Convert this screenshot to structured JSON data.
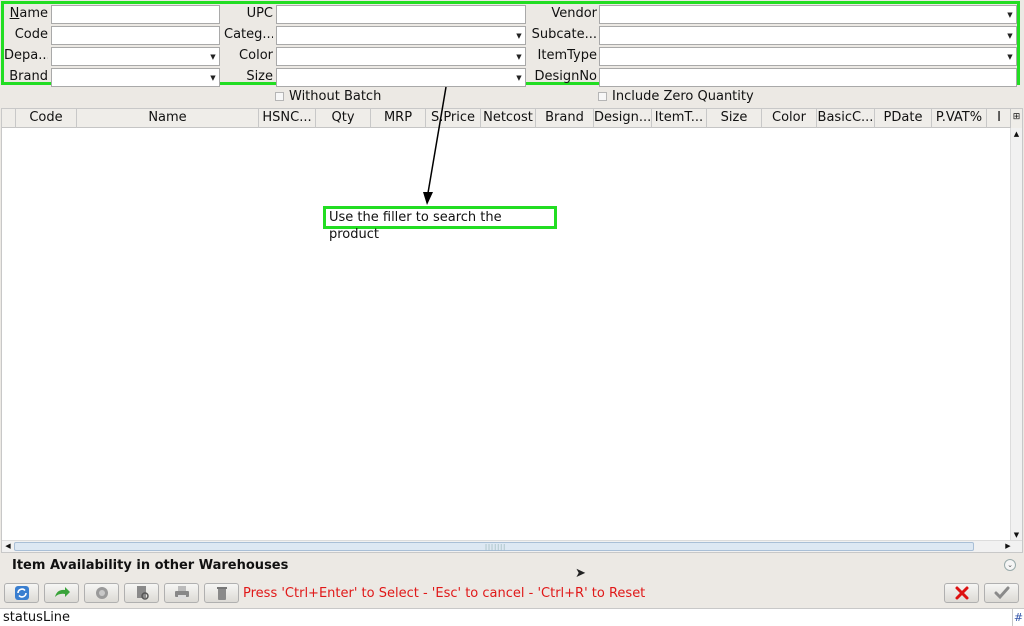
{
  "filters": {
    "col1": [
      {
        "label": "Name",
        "mnemonic": true,
        "value": "",
        "dropdown": false
      },
      {
        "label": "Code",
        "value": "",
        "dropdown": false
      },
      {
        "label": "Depa...",
        "value": "",
        "dropdown": true
      },
      {
        "label": "Brand",
        "value": "",
        "dropdown": true
      }
    ],
    "col2": [
      {
        "label": "UPC",
        "value": "",
        "dropdown": false
      },
      {
        "label": "Categ...",
        "value": "",
        "dropdown": true
      },
      {
        "label": "Color",
        "value": "",
        "dropdown": true
      },
      {
        "label": "Size",
        "value": "",
        "dropdown": true
      }
    ],
    "col3": [
      {
        "label": "Vendor",
        "value": "",
        "dropdown": true
      },
      {
        "label": "Subcate...",
        "value": "",
        "dropdown": true
      },
      {
        "label": "ItemType",
        "value": "",
        "dropdown": true
      },
      {
        "label": "DesignNo",
        "value": "",
        "dropdown": false
      }
    ]
  },
  "checkboxes": {
    "without_batch": {
      "label": "Without Batch",
      "checked": false
    },
    "include_zero_qty": {
      "label": "Include Zero Quantity",
      "checked": false
    }
  },
  "table": {
    "columns": [
      "Code",
      "Name",
      "HSNC...",
      "Qty",
      "MRP",
      "S.Price",
      "Netcost",
      "Brand",
      "Design...",
      "ItemT...",
      "Size",
      "Color",
      "BasicC...",
      "PDate",
      "P.VAT%",
      "I"
    ],
    "rows": []
  },
  "annotation": {
    "text": "Use the filler to search the product",
    "color": "#22dd22"
  },
  "section": {
    "title": "Item Availability in other Warehouses"
  },
  "toolbar": {
    "buttons": [
      "refresh-icon",
      "forward-arrow-icon",
      "stamp-icon",
      "document-search-icon",
      "print-icon",
      "trash-icon"
    ],
    "hint": "Press 'Ctrl+Enter' to Select - 'Esc' to cancel - 'Ctrl+R' to Reset",
    "hint_color": "#e01818"
  },
  "status": {
    "text": "statusLine",
    "hash": "#"
  },
  "colors": {
    "accent_green": "#22dd22",
    "cancel_red": "#dd1111",
    "ok_grey": "#8a8a8a"
  }
}
